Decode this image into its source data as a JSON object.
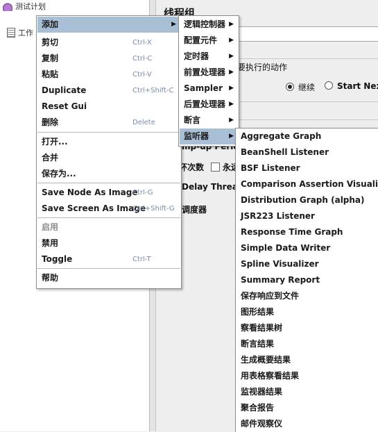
{
  "tree": {
    "items": [
      "测试计划",
      "工作"
    ]
  },
  "content": {
    "title": "线程组",
    "action_label": "要执行的动作",
    "radio_continue": "继续",
    "radio_start_next": "Start Next",
    "rampup_label": "mp-up Period",
    "loop_label": "环次数",
    "forever_label": "永远",
    "delay_label": "Delay Thread",
    "scheduler_label": "调度器"
  },
  "main_menu": {
    "items": [
      {
        "label": "添加",
        "accel": "",
        "submenu": true,
        "selected": true
      },
      {
        "label": "剪切",
        "accel": "Ctrl-X"
      },
      {
        "label": "复制",
        "accel": "Ctrl-C"
      },
      {
        "label": "粘贴",
        "accel": "Ctrl-V"
      },
      {
        "label": "Duplicate",
        "accel": "Ctrl+Shift-C"
      },
      {
        "label": "Reset Gui",
        "accel": ""
      },
      {
        "label": "删除",
        "accel": "Delete"
      },
      {
        "label": "打开...",
        "accel": ""
      },
      {
        "label": "合并",
        "accel": ""
      },
      {
        "label": "保存为...",
        "accel": ""
      },
      {
        "label": "Save Node As Image",
        "accel": "Ctrl-G"
      },
      {
        "label": "Save Screen As Image",
        "accel": "Ctrl+Shift-G"
      },
      {
        "label": "启用",
        "accel": "",
        "disabled": true
      },
      {
        "label": "禁用",
        "accel": ""
      },
      {
        "label": "Toggle",
        "accel": "Ctrl-T"
      },
      {
        "label": "帮助",
        "accel": ""
      }
    ]
  },
  "add_menu": {
    "items": [
      {
        "label": "逻辑控制器",
        "submenu": true
      },
      {
        "label": "配置元件",
        "submenu": true
      },
      {
        "label": "定时器",
        "submenu": true
      },
      {
        "label": "前置处理器",
        "submenu": true
      },
      {
        "label": "Sampler",
        "submenu": true
      },
      {
        "label": "后置处理器",
        "submenu": true
      },
      {
        "label": "断言",
        "submenu": true
      },
      {
        "label": "监听器",
        "submenu": true,
        "selected": true
      }
    ]
  },
  "listener_menu": {
    "items": [
      "Aggregate Graph",
      "BeanShell Listener",
      "BSF Listener",
      "Comparison Assertion Visualizer",
      "Distribution Graph (alpha)",
      "JSR223 Listener",
      "Response Time Graph",
      "Simple Data Writer",
      "Spline Visualizer",
      "Summary Report",
      "保存响应到文件",
      "图形结果",
      "察看结果树",
      "断言结果",
      "生成概要结果",
      "用表格察看结果",
      "监视器结果",
      "聚合报告",
      "邮件观察仪"
    ]
  },
  "icons": {
    "submenu_arrow": "chevron-right-icon",
    "test_plan": "flask-icon",
    "workbench": "clipboard-icon"
  },
  "colors": {
    "selection": "#a9bfd6",
    "accelerator": "#7a8aa8",
    "disabled": "#8e8e8e"
  }
}
